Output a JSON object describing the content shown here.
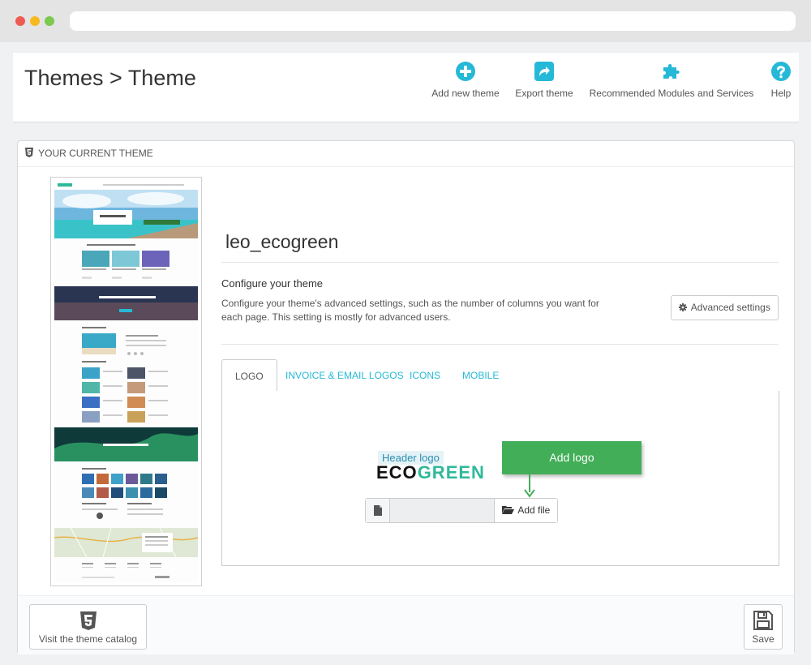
{
  "page": {
    "title": "Themes > Theme"
  },
  "toolbar": {
    "add_new_theme": "Add new theme",
    "export_theme": "Export theme",
    "recommended": "Recommended Modules and Services",
    "help": "Help"
  },
  "panel": {
    "heading": "YOUR CURRENT THEME",
    "theme_name": "leo_ecogreen",
    "config_title": "Configure your theme",
    "config_desc": "Configure your theme's advanced settings, such as the number of columns you want for each page. This setting is mostly for advanced users.",
    "advanced_button": "Advanced settings"
  },
  "tabs": [
    {
      "label": "LOGO",
      "active": true
    },
    {
      "label": "INVOICE & EMAIL LOGOS",
      "active": false
    },
    {
      "label": "ICONS",
      "active": false
    },
    {
      "label": "MOBILE",
      "active": false
    }
  ],
  "logo_tab": {
    "header_logo_label": "Header logo",
    "logo_text_eco": "ECO",
    "logo_text_green": "GREEN",
    "add_file_button": "Add file",
    "callout": "Add logo"
  },
  "footer": {
    "catalog_button": "Visit the theme catalog",
    "save_button": "Save"
  },
  "colors": {
    "accent": "#25b9d7",
    "callout_green": "#42ae58",
    "logo_green": "#2fb99b"
  }
}
